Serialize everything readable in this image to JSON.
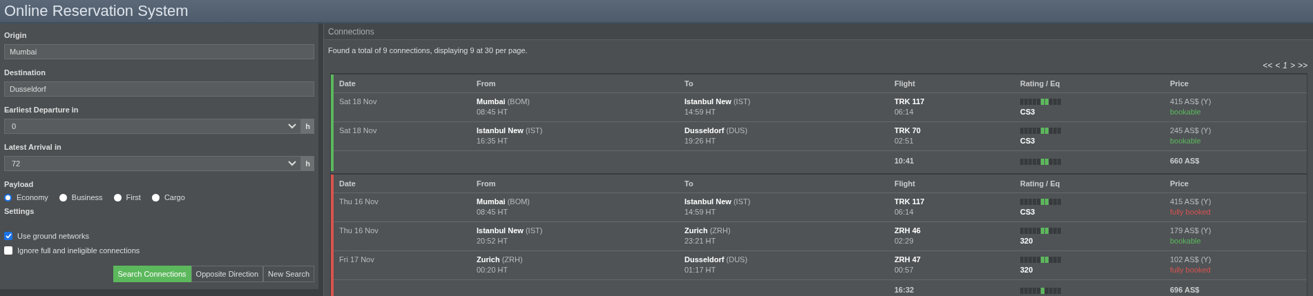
{
  "window": {
    "title": "Online Reservation System"
  },
  "search_form": {
    "fields": [
      {
        "kind": "text",
        "label": "Origin",
        "value": "Mumbai"
      },
      {
        "kind": "text",
        "label": "Destination",
        "value": "Dusseldorf"
      },
      {
        "kind": "select",
        "label": "Earliest Departure in",
        "value": "0",
        "unit": "h"
      },
      {
        "kind": "select",
        "label": "Latest Arrival in",
        "value": "72",
        "unit": "h"
      }
    ],
    "payload": {
      "label": "Payload",
      "options": [
        {
          "label": "Economy",
          "selected": true
        },
        {
          "label": "Business",
          "selected": false
        },
        {
          "label": "First",
          "selected": false
        },
        {
          "label": "Cargo",
          "selected": false
        }
      ]
    },
    "settings": {
      "label": "Settings",
      "options": [
        {
          "label": "Use ground networks",
          "checked": true
        },
        {
          "label": "Ignore full and ineligible connections",
          "checked": false
        }
      ]
    },
    "buttons": [
      {
        "label": "Search Connections",
        "primary": true
      },
      {
        "label": "Opposite Direction",
        "primary": false
      },
      {
        "label": "New Search",
        "primary": false
      }
    ]
  },
  "connections": {
    "title": "Connections",
    "summary": "Found a total of 9 connections, displaying 9 at 30 per page.",
    "pager": [
      "<<",
      "<",
      "1",
      ">",
      ">>"
    ],
    "groups": [
      {
        "color": "#5cb85c",
        "columns": [
          "Date",
          "From",
          "To",
          "Flight",
          "Rating / Eq",
          "Price"
        ],
        "legs": [
          {
            "date": "Sat 18 Nov",
            "from": "Mumbai",
            "from_code": "(BOM)",
            "dep": "08:45 HT",
            "to": "Istanbul New",
            "to_code": "(IST)",
            "arr": "14:59 HT",
            "flight": "TRK 117",
            "duration": "06:14",
            "rating": [
              false,
              false,
              false,
              false,
              false,
              true,
              true,
              false,
              false,
              false
            ],
            "eq": "CS3",
            "price": "415 AS$ (Y)",
            "availability": "bookable",
            "bookable": true
          },
          {
            "date": "Sat 18 Nov",
            "from": "Istanbul New",
            "from_code": "(IST)",
            "dep": "16:35 HT",
            "to": "Dusseldorf",
            "to_code": "(DUS)",
            "arr": "19:26 HT",
            "flight": "TRK 70",
            "duration": "02:51",
            "rating": [
              false,
              false,
              false,
              false,
              false,
              true,
              true,
              false,
              false,
              false
            ],
            "eq": "CS3",
            "price": "245 AS$ (Y)",
            "availability": "bookable",
            "bookable": true
          }
        ],
        "total": {
          "duration": "10:41",
          "rating": [
            false,
            false,
            false,
            false,
            false,
            true,
            true,
            false,
            false,
            false
          ],
          "price": "660 AS$"
        }
      },
      {
        "color": "#d9534f",
        "columns": [
          "Date",
          "From",
          "To",
          "Flight",
          "Rating / Eq",
          "Price"
        ],
        "legs": [
          {
            "date": "Thu 16 Nov",
            "from": "Mumbai",
            "from_code": "(BOM)",
            "dep": "08:45 HT",
            "to": "Istanbul New",
            "to_code": "(IST)",
            "arr": "14:59 HT",
            "flight": "TRK 117",
            "duration": "06:14",
            "rating": [
              false,
              false,
              false,
              false,
              false,
              true,
              true,
              false,
              false,
              false
            ],
            "eq": "CS3",
            "price": "415 AS$ (Y)",
            "availability": "fully booked",
            "bookable": false
          },
          {
            "date": "Thu 16 Nov",
            "from": "Istanbul New",
            "from_code": "(IST)",
            "dep": "20:52 HT",
            "to": "Zurich",
            "to_code": "(ZRH)",
            "arr": "23:21 HT",
            "flight": "ZRH 46",
            "duration": "02:29",
            "rating": [
              false,
              false,
              false,
              false,
              false,
              true,
              true,
              false,
              false,
              false
            ],
            "eq": "320",
            "price": "179 AS$ (Y)",
            "availability": "bookable",
            "bookable": true
          },
          {
            "date": "Fri 17 Nov",
            "from": "Zurich",
            "from_code": "(ZRH)",
            "dep": "00:20 HT",
            "to": "Dusseldorf",
            "to_code": "(DUS)",
            "arr": "01:17 HT",
            "flight": "ZRH 47",
            "duration": "00:57",
            "rating": [
              false,
              false,
              false,
              false,
              false,
              true,
              true,
              false,
              false,
              false
            ],
            "eq": "320",
            "price": "102 AS$ (Y)",
            "availability": "fully booked",
            "bookable": false
          }
        ],
        "total": {
          "duration": "16:32",
          "rating": [
            false,
            false,
            false,
            false,
            false,
            true,
            false,
            false,
            false,
            false
          ],
          "price": "696 AS$"
        }
      }
    ]
  }
}
